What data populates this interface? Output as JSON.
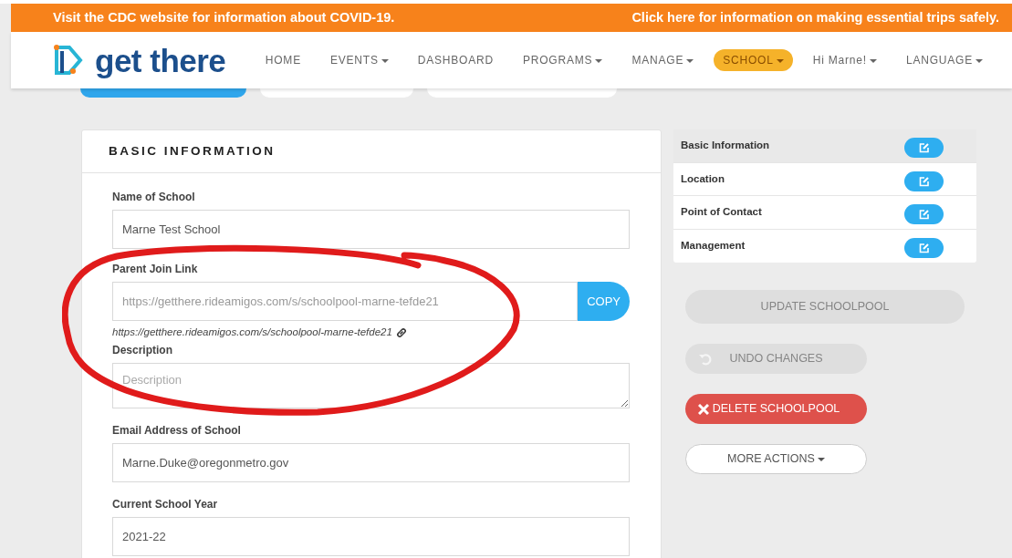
{
  "banner": {
    "left": "Visit the CDC website for information about COVID-19.",
    "right": "Click here for information on making essential trips safely."
  },
  "brand": {
    "name": "get there"
  },
  "nav": [
    {
      "label": "HOME",
      "dropdown": false,
      "selected": false
    },
    {
      "label": "EVENTS",
      "dropdown": true,
      "selected": false
    },
    {
      "label": "DASHBOARD",
      "dropdown": false,
      "selected": false
    },
    {
      "label": "PROGRAMS",
      "dropdown": true,
      "selected": false
    },
    {
      "label": "MANAGE",
      "dropdown": true,
      "selected": false
    },
    {
      "label": "SCHOOL",
      "dropdown": true,
      "selected": true
    },
    {
      "label": "Hi Marne!",
      "dropdown": true,
      "selected": false
    },
    {
      "label": "LANGUAGE",
      "dropdown": true,
      "selected": false
    }
  ],
  "tabs": [
    {
      "selected": true
    },
    {
      "selected": false
    },
    {
      "selected": false
    }
  ],
  "card": {
    "title": "BASIC INFORMATION",
    "fields": [
      {
        "kind": "text",
        "label": "Name of School",
        "value": "Marne Test School"
      },
      {
        "kind": "link",
        "label": "Parent Join Link",
        "placeholder": "https://getthere.rideamigos.com/s/schoolpool-marne-tefde21",
        "button": "COPY",
        "link": "https://getthere.rideamigos.com/s/schoolpool-marne-tefde21"
      },
      {
        "kind": "textarea",
        "label": "Description",
        "placeholder": "Description"
      },
      {
        "kind": "text",
        "label": "Email Address of School",
        "value": "Marne.Duke@oregonmetro.gov"
      },
      {
        "kind": "text",
        "label": "Current School Year",
        "value": "2021-22"
      }
    ]
  },
  "sections": [
    {
      "label": "Basic Information",
      "selected": true
    },
    {
      "label": "Location",
      "selected": false
    },
    {
      "label": "Point of Contact",
      "selected": false
    },
    {
      "label": "Management",
      "selected": false
    }
  ],
  "actions": [
    {
      "kind": "update",
      "label": "UPDATE SCHOOLPOOL",
      "disabled": true
    },
    {
      "kind": "undo",
      "label": "UNDO CHANGES",
      "disabled": true
    },
    {
      "kind": "delete",
      "label": "DELETE SCHOOLPOOL",
      "disabled": false
    },
    {
      "kind": "more",
      "label": "MORE ACTIONS",
      "disabled": false
    }
  ]
}
